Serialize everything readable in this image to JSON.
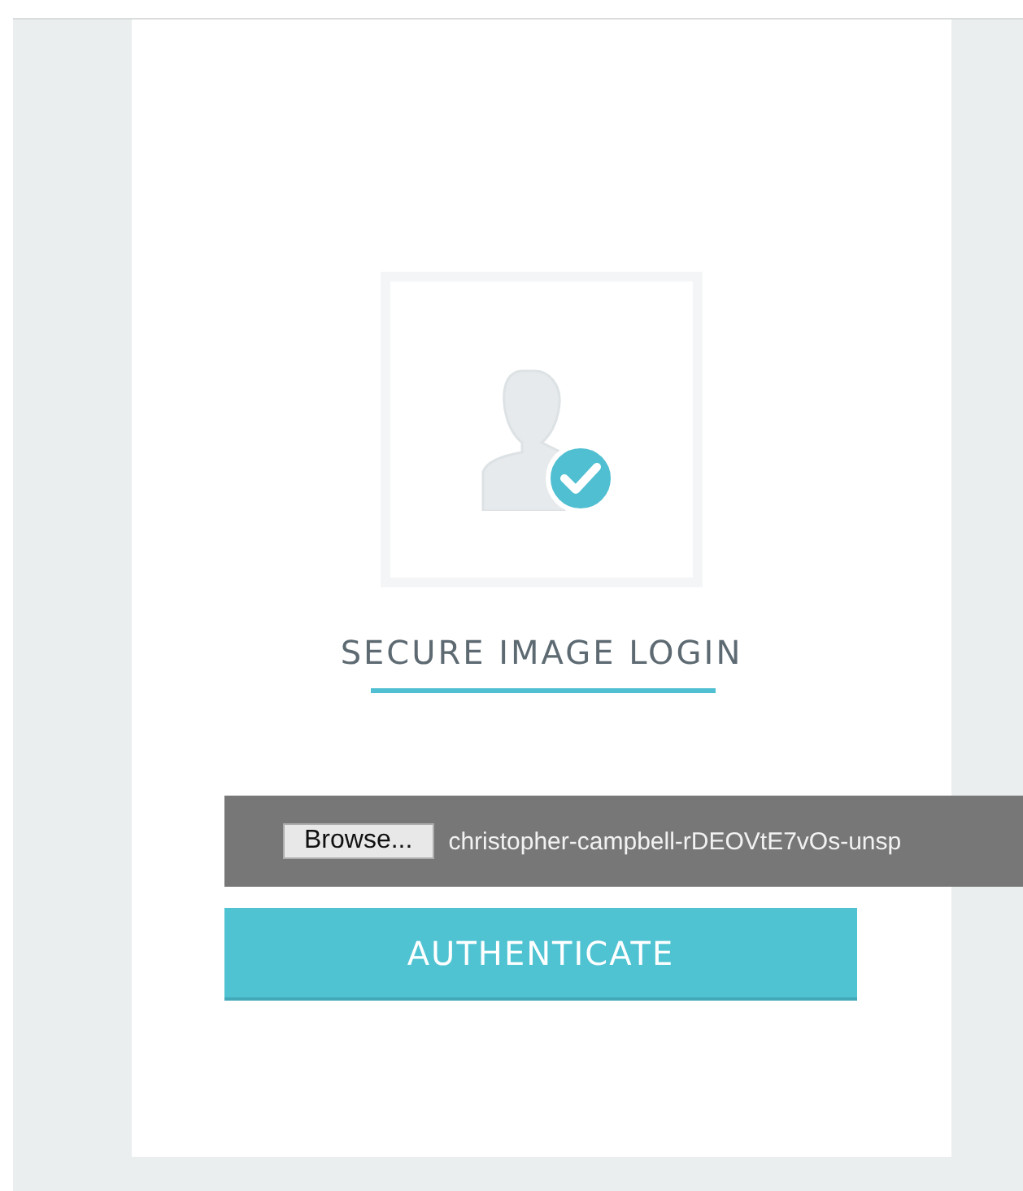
{
  "login": {
    "title": "SECURE IMAGE LOGIN",
    "file_input": {
      "button": "Browse...",
      "value": "christopher-campbell-rDEOVtE7vOs-unsp"
    },
    "submit": "AUTHENTICATE"
  }
}
